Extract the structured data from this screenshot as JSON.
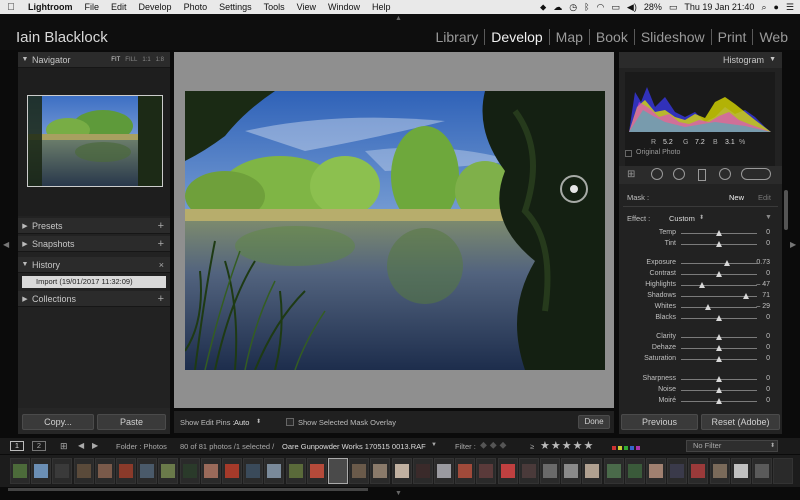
{
  "menubar": {
    "app_name": "Lightroom",
    "menus": [
      "File",
      "Edit",
      "Develop",
      "Photo",
      "Settings",
      "Tools",
      "View",
      "Window",
      "Help"
    ],
    "battery": "28%",
    "datetime": "Thu 19 Jan  21:40"
  },
  "identity_plate": "Iain Blacklock",
  "modules": [
    "Library",
    "Develop",
    "Map",
    "Book",
    "Slideshow",
    "Print",
    "Web"
  ],
  "active_module": "Develop",
  "left_panel": {
    "navigator_title": "Navigator",
    "zoom_options": [
      "FIT",
      "FILL",
      "1:1",
      "1:8"
    ],
    "presets": "Presets",
    "snapshots": "Snapshots",
    "history": "History",
    "history_close": "×",
    "history_items": [
      "Import (19/01/2017 11:32:09)"
    ],
    "collections": "Collections",
    "copy_button": "Copy...",
    "paste_button": "Paste"
  },
  "toolbar": {
    "show_edit_pins_label": "Show Edit Pins :",
    "show_edit_pins_value": "Auto",
    "mask_overlay_label": "Show Selected Mask Overlay",
    "done_button": "Done"
  },
  "right_panel": {
    "histogram_title": "Histogram",
    "rgb_readout": {
      "r_label": "R",
      "r": "5.2",
      "g_label": "G",
      "g": "7.2",
      "b_label": "B",
      "b": "3.1",
      "unit": "%"
    },
    "original_photo": "Original Photo",
    "mask_label": "Mask :",
    "mask_new": "New",
    "mask_edit": "Edit",
    "effect_label": "Effect :",
    "effect_value": "Custom",
    "sliders": [
      {
        "label": "Temp",
        "value": "0",
        "pos": 0.5
      },
      {
        "label": "Tint",
        "value": "0",
        "pos": 0.5
      },
      {
        "label": "Exposure",
        "value": "0.73",
        "pos": 0.6
      },
      {
        "label": "Contrast",
        "value": "0",
        "pos": 0.5
      },
      {
        "label": "Highlights",
        "value": "– 47",
        "pos": 0.27
      },
      {
        "label": "Shadows",
        "value": "71",
        "pos": 0.85
      },
      {
        "label": "Whites",
        "value": "– 29",
        "pos": 0.35
      },
      {
        "label": "Blacks",
        "value": "0",
        "pos": 0.5
      },
      {
        "label": "Clarity",
        "value": "0",
        "pos": 0.5
      },
      {
        "label": "Dehaze",
        "value": "0",
        "pos": 0.5
      },
      {
        "label": "Saturation",
        "value": "0",
        "pos": 0.5
      },
      {
        "label": "Sharpness",
        "value": "0",
        "pos": 0.5
      },
      {
        "label": "Noise",
        "value": "0",
        "pos": 0.5
      },
      {
        "label": "Moiré",
        "value": "0",
        "pos": 0.5
      }
    ],
    "previous_button": "Previous",
    "reset_button": "Reset (Adobe)"
  },
  "film_bar": {
    "monitor_1": "1",
    "monitor_2": "2",
    "source": "Folder : Photos",
    "count": "80 of 81 photos /1 selected /",
    "filename": "Oare Gunpowder Works 170515 0013.RAF",
    "filter_label": "Filter :",
    "rating_op": "≥",
    "filter_value": "No Filter"
  },
  "colors": {
    "accent_panel": "#222222",
    "selected_history": "#d9d9d9",
    "background": "#0b0b0b"
  }
}
